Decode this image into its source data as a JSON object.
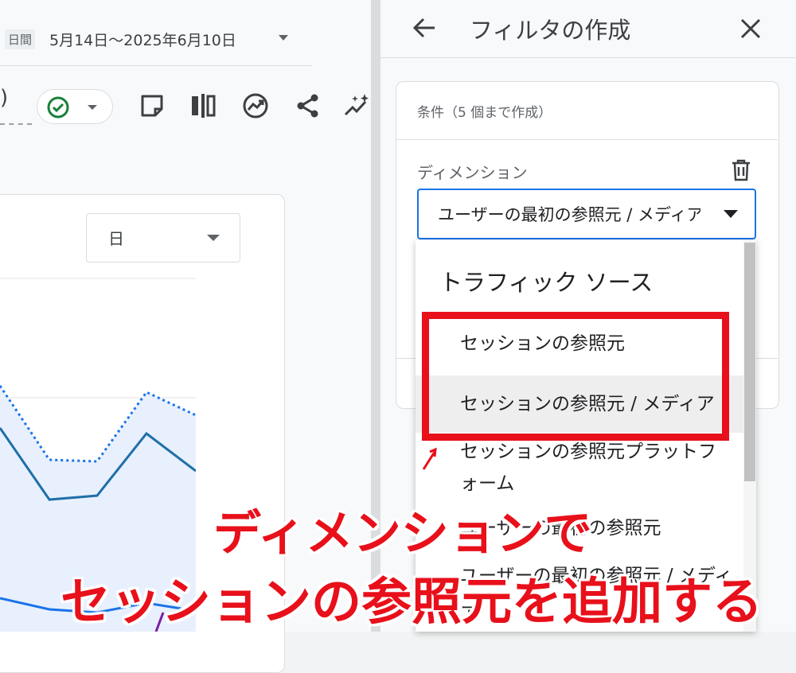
{
  "report": {
    "date_label": "日間",
    "date_range": "5月14日～2025年6月10日",
    "paren_text": ")",
    "granularity": "日"
  },
  "filter_panel": {
    "title": "フィルタの作成",
    "condition_title": "条件（5 個まで作成）",
    "dimension_label": "ディメンション",
    "dimension_value": "ユーザーの最初の参照元 / メディア",
    "dropdown": {
      "group": "トラフィック ソース",
      "items": [
        "セッションの参照元",
        "セッションの参照元 / メディア",
        "セッションの参照元プラットフォーム",
        "ユーザーの最初の参照元",
        "ユーザーの最初の参照元 / メディア"
      ],
      "item2_line1": "セッションの参照元プラットフ",
      "item2_line2": "ォーム"
    }
  },
  "annotation": {
    "line1": "ディメンションで",
    "line2": "セッションの参照元を追加する"
  },
  "colors": {
    "accent": "#1a73e8",
    "annotation": "#e8101a",
    "status_check": "#188038"
  },
  "icons": [
    "arrow-back-icon",
    "close-icon",
    "trash-icon",
    "check-circle-icon",
    "note-icon",
    "compare-icon",
    "insights-icon",
    "share-icon",
    "sparkle-icon"
  ]
}
